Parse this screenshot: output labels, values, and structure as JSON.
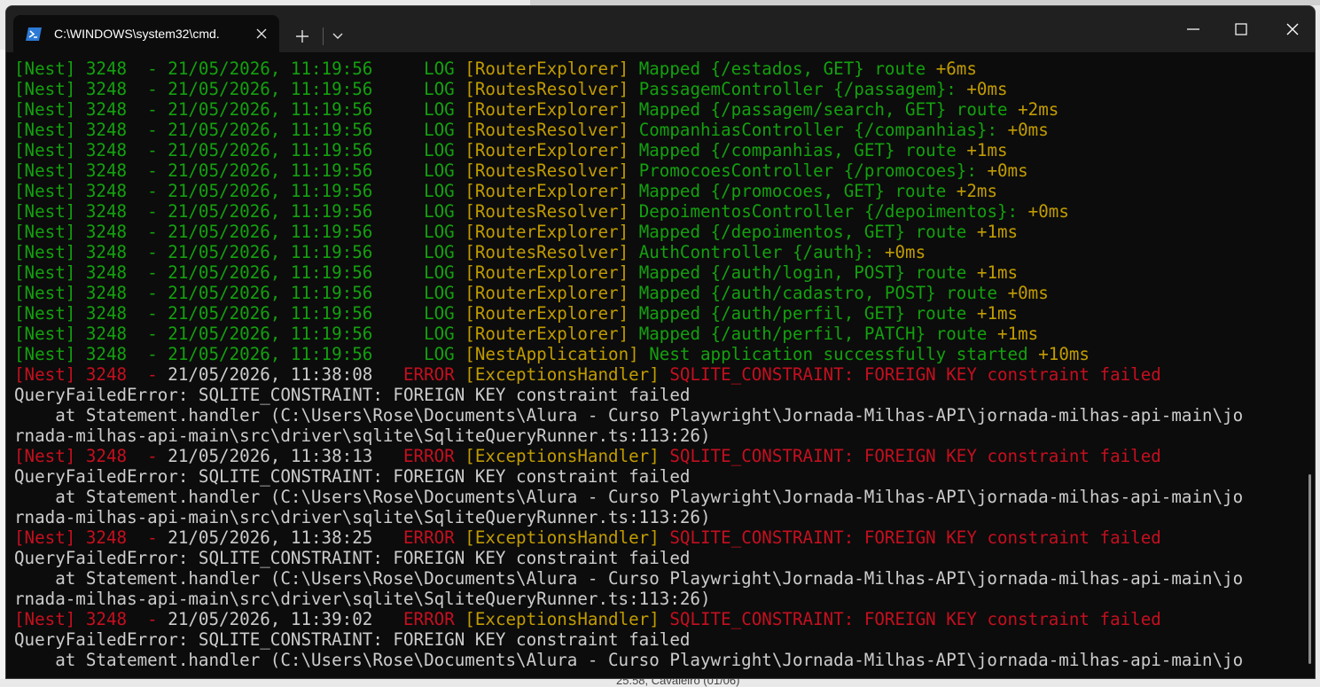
{
  "window": {
    "tab_title": "C:\\WINDOWS\\system32\\cmd.",
    "background_hint": "25.58, Cavaleiro (01/06)"
  },
  "colors": {
    "log_green": "#13a10e",
    "log_yellow": "#c19c00",
    "error_red": "#c50f1f",
    "plain_text": "#cccccc",
    "console_bg": "#0c0c0c",
    "titlebar_bg": "#202020"
  },
  "icons": {
    "tab_icon": "powershell-icon",
    "tab_close": "close-icon",
    "new_tab": "plus-icon",
    "dropdown": "chevron-down-icon",
    "minimize": "minimize-icon",
    "maximize": "maximize-icon",
    "close": "close-icon"
  },
  "console": {
    "lines": [
      [
        [
          "c-green",
          "[Nest] 3248  - 21/05/2026, 11:19:56     LOG "
        ],
        [
          "c-yellow",
          "[RouterExplorer] "
        ],
        [
          "c-green",
          "Mapped {/estados, GET} route "
        ],
        [
          "c-yellow",
          "+6ms"
        ]
      ],
      [
        [
          "c-green",
          "[Nest] 3248  - 21/05/2026, 11:19:56     LOG "
        ],
        [
          "c-yellow",
          "[RoutesResolver] "
        ],
        [
          "c-green",
          "PassagemController {/passagem}: "
        ],
        [
          "c-yellow",
          "+0ms"
        ]
      ],
      [
        [
          "c-green",
          "[Nest] 3248  - 21/05/2026, 11:19:56     LOG "
        ],
        [
          "c-yellow",
          "[RouterExplorer] "
        ],
        [
          "c-green",
          "Mapped {/passagem/search, GET} route "
        ],
        [
          "c-yellow",
          "+2ms"
        ]
      ],
      [
        [
          "c-green",
          "[Nest] 3248  - 21/05/2026, 11:19:56     LOG "
        ],
        [
          "c-yellow",
          "[RoutesResolver] "
        ],
        [
          "c-green",
          "CompanhiasController {/companhias}: "
        ],
        [
          "c-yellow",
          "+0ms"
        ]
      ],
      [
        [
          "c-green",
          "[Nest] 3248  - 21/05/2026, 11:19:56     LOG "
        ],
        [
          "c-yellow",
          "[RouterExplorer] "
        ],
        [
          "c-green",
          "Mapped {/companhias, GET} route "
        ],
        [
          "c-yellow",
          "+1ms"
        ]
      ],
      [
        [
          "c-green",
          "[Nest] 3248  - 21/05/2026, 11:19:56     LOG "
        ],
        [
          "c-yellow",
          "[RoutesResolver] "
        ],
        [
          "c-green",
          "PromocoesController {/promocoes}: "
        ],
        [
          "c-yellow",
          "+0ms"
        ]
      ],
      [
        [
          "c-green",
          "[Nest] 3248  - 21/05/2026, 11:19:56     LOG "
        ],
        [
          "c-yellow",
          "[RouterExplorer] "
        ],
        [
          "c-green",
          "Mapped {/promocoes, GET} route "
        ],
        [
          "c-yellow",
          "+2ms"
        ]
      ],
      [
        [
          "c-green",
          "[Nest] 3248  - 21/05/2026, 11:19:56     LOG "
        ],
        [
          "c-yellow",
          "[RoutesResolver] "
        ],
        [
          "c-green",
          "DepoimentosController {/depoimentos}: "
        ],
        [
          "c-yellow",
          "+0ms"
        ]
      ],
      [
        [
          "c-green",
          "[Nest] 3248  - 21/05/2026, 11:19:56     LOG "
        ],
        [
          "c-yellow",
          "[RouterExplorer] "
        ],
        [
          "c-green",
          "Mapped {/depoimentos, GET} route "
        ],
        [
          "c-yellow",
          "+1ms"
        ]
      ],
      [
        [
          "c-green",
          "[Nest] 3248  - 21/05/2026, 11:19:56     LOG "
        ],
        [
          "c-yellow",
          "[RoutesResolver] "
        ],
        [
          "c-green",
          "AuthController {/auth}: "
        ],
        [
          "c-yellow",
          "+0ms"
        ]
      ],
      [
        [
          "c-green",
          "[Nest] 3248  - 21/05/2026, 11:19:56     LOG "
        ],
        [
          "c-yellow",
          "[RouterExplorer] "
        ],
        [
          "c-green",
          "Mapped {/auth/login, POST} route "
        ],
        [
          "c-yellow",
          "+1ms"
        ]
      ],
      [
        [
          "c-green",
          "[Nest] 3248  - 21/05/2026, 11:19:56     LOG "
        ],
        [
          "c-yellow",
          "[RouterExplorer] "
        ],
        [
          "c-green",
          "Mapped {/auth/cadastro, POST} route "
        ],
        [
          "c-yellow",
          "+0ms"
        ]
      ],
      [
        [
          "c-green",
          "[Nest] 3248  - 21/05/2026, 11:19:56     LOG "
        ],
        [
          "c-yellow",
          "[RouterExplorer] "
        ],
        [
          "c-green",
          "Mapped {/auth/perfil, GET} route "
        ],
        [
          "c-yellow",
          "+1ms"
        ]
      ],
      [
        [
          "c-green",
          "[Nest] 3248  - 21/05/2026, 11:19:56     LOG "
        ],
        [
          "c-yellow",
          "[RouterExplorer] "
        ],
        [
          "c-green",
          "Mapped {/auth/perfil, PATCH} route "
        ],
        [
          "c-yellow",
          "+1ms"
        ]
      ],
      [
        [
          "c-green",
          "[Nest] 3248  - 21/05/2026, 11:19:56     LOG "
        ],
        [
          "c-yellow",
          "[NestApplication] "
        ],
        [
          "c-green",
          "Nest application successfully started "
        ],
        [
          "c-yellow",
          "+10ms"
        ]
      ],
      [
        [
          "c-red",
          "[Nest] 3248  - "
        ],
        [
          "c-white",
          "21/05/2026, 11:38:08   "
        ],
        [
          "c-red",
          "ERROR "
        ],
        [
          "c-yellow",
          "[ExceptionsHandler] "
        ],
        [
          "c-red",
          "SQLITE_CONSTRAINT: FOREIGN KEY constraint failed"
        ]
      ],
      [
        [
          "c-white",
          "QueryFailedError: SQLITE_CONSTRAINT: FOREIGN KEY constraint failed"
        ]
      ],
      [
        [
          "c-white",
          "    at Statement.handler (C:\\Users\\Rose\\Documents\\Alura - Curso Playwright\\Jornada-Milhas-API\\jornada-milhas-api-main\\jo"
        ]
      ],
      [
        [
          "c-white",
          "rnada-milhas-api-main\\src\\driver\\sqlite\\SqliteQueryRunner.ts:113:26)"
        ]
      ],
      [
        [
          "c-red",
          "[Nest] 3248  - "
        ],
        [
          "c-white",
          "21/05/2026, 11:38:13   "
        ],
        [
          "c-red",
          "ERROR "
        ],
        [
          "c-yellow",
          "[ExceptionsHandler] "
        ],
        [
          "c-red",
          "SQLITE_CONSTRAINT: FOREIGN KEY constraint failed"
        ]
      ],
      [
        [
          "c-white",
          "QueryFailedError: SQLITE_CONSTRAINT: FOREIGN KEY constraint failed"
        ]
      ],
      [
        [
          "c-white",
          "    at Statement.handler (C:\\Users\\Rose\\Documents\\Alura - Curso Playwright\\Jornada-Milhas-API\\jornada-milhas-api-main\\jo"
        ]
      ],
      [
        [
          "c-white",
          "rnada-milhas-api-main\\src\\driver\\sqlite\\SqliteQueryRunner.ts:113:26)"
        ]
      ],
      [
        [
          "c-red",
          "[Nest] 3248  - "
        ],
        [
          "c-white",
          "21/05/2026, 11:38:25   "
        ],
        [
          "c-red",
          "ERROR "
        ],
        [
          "c-yellow",
          "[ExceptionsHandler] "
        ],
        [
          "c-red",
          "SQLITE_CONSTRAINT: FOREIGN KEY constraint failed"
        ]
      ],
      [
        [
          "c-white",
          "QueryFailedError: SQLITE_CONSTRAINT: FOREIGN KEY constraint failed"
        ]
      ],
      [
        [
          "c-white",
          "    at Statement.handler (C:\\Users\\Rose\\Documents\\Alura - Curso Playwright\\Jornada-Milhas-API\\jornada-milhas-api-main\\jo"
        ]
      ],
      [
        [
          "c-white",
          "rnada-milhas-api-main\\src\\driver\\sqlite\\SqliteQueryRunner.ts:113:26)"
        ]
      ],
      [
        [
          "c-red",
          "[Nest] 3248  - "
        ],
        [
          "c-white",
          "21/05/2026, 11:39:02   "
        ],
        [
          "c-red",
          "ERROR "
        ],
        [
          "c-yellow",
          "[ExceptionsHandler] "
        ],
        [
          "c-red",
          "SQLITE_CONSTRAINT: FOREIGN KEY constraint failed"
        ]
      ],
      [
        [
          "c-white",
          "QueryFailedError: SQLITE_CONSTRAINT: FOREIGN KEY constraint failed"
        ]
      ],
      [
        [
          "c-white",
          "    at Statement.handler (C:\\Users\\Rose\\Documents\\Alura - Curso Playwright\\Jornada-Milhas-API\\jornada-milhas-api-main\\jo"
        ]
      ]
    ]
  }
}
